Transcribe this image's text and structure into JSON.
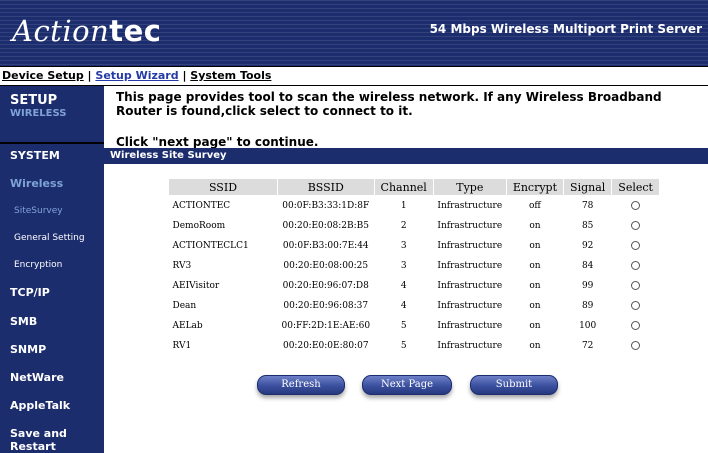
{
  "header": {
    "logo_script": "Action",
    "logo_bold": "tec",
    "product": "54 Mbps Wireless Multiport Print Server"
  },
  "topnav": {
    "device_setup": "Device Setup",
    "separator1": " | ",
    "setup_wizard": "Setup Wizard",
    "separator2": " | ",
    "system_tools": "System Tools"
  },
  "sidebar": {
    "setup_title": "SETUP",
    "setup_sub": "WIRELESS",
    "items": [
      {
        "label": "SYSTEM"
      },
      {
        "label": "Wireless"
      },
      {
        "label": "SiteSurvey"
      },
      {
        "label": "General Setting"
      },
      {
        "label": "Encryption"
      },
      {
        "label": "TCP/IP"
      },
      {
        "label": "SMB"
      },
      {
        "label": "SNMP"
      },
      {
        "label": "NetWare"
      },
      {
        "label": "AppleTalk"
      },
      {
        "label": "Save and Restart"
      }
    ]
  },
  "content": {
    "info": "This page provides tool to scan the wireless network. If any Wireless Broadband Router is found,click select to connect to it.",
    "next_note": "Click \"next page\" to continue.",
    "survey_title": "Wireless Site Survey"
  },
  "table": {
    "headers": [
      "SSID",
      "BSSID",
      "Channel",
      "Type",
      "Encrypt",
      "Signal",
      "Select"
    ],
    "rows": [
      {
        "ssid": "ACTIONTEC",
        "bssid": "00:0F:B3:33:1D:8F",
        "channel": "1",
        "type": "Infrastructure",
        "encrypt": "off",
        "signal": "78"
      },
      {
        "ssid": "DemoRoom",
        "bssid": "00:20:E0:08:2B:B5",
        "channel": "2",
        "type": "Infrastructure",
        "encrypt": "on",
        "signal": "85"
      },
      {
        "ssid": "ACTIONTECLC1",
        "bssid": "00:0F:B3:00:7E:44",
        "channel": "3",
        "type": "Infrastructure",
        "encrypt": "on",
        "signal": "92"
      },
      {
        "ssid": "RV3",
        "bssid": "00:20:E0:08:00:25",
        "channel": "3",
        "type": "Infrastructure",
        "encrypt": "on",
        "signal": "84"
      },
      {
        "ssid": "AEIVisitor",
        "bssid": "00:20:E0:96:07:D8",
        "channel": "4",
        "type": "Infrastructure",
        "encrypt": "on",
        "signal": "99"
      },
      {
        "ssid": "Dean",
        "bssid": "00:20:E0:96:08:37",
        "channel": "4",
        "type": "Infrastructure",
        "encrypt": "on",
        "signal": "89"
      },
      {
        "ssid": "AELab",
        "bssid": "00:FF:2D:1E:AE:60",
        "channel": "5",
        "type": "Infrastructure",
        "encrypt": "on",
        "signal": "100"
      },
      {
        "ssid": "RV1",
        "bssid": "00:20:E0:0E:80:07",
        "channel": "5",
        "type": "Infrastructure",
        "encrypt": "on",
        "signal": "72"
      }
    ]
  },
  "buttons": {
    "refresh": "Refresh",
    "next_page": "Next Page",
    "submit": "Submit"
  },
  "colors": {
    "navy": "#1c2d6e",
    "light_blue_text": "#7fa3d6",
    "link_blue": "#243aa8",
    "table_header_gray": "#dcdcdc"
  }
}
